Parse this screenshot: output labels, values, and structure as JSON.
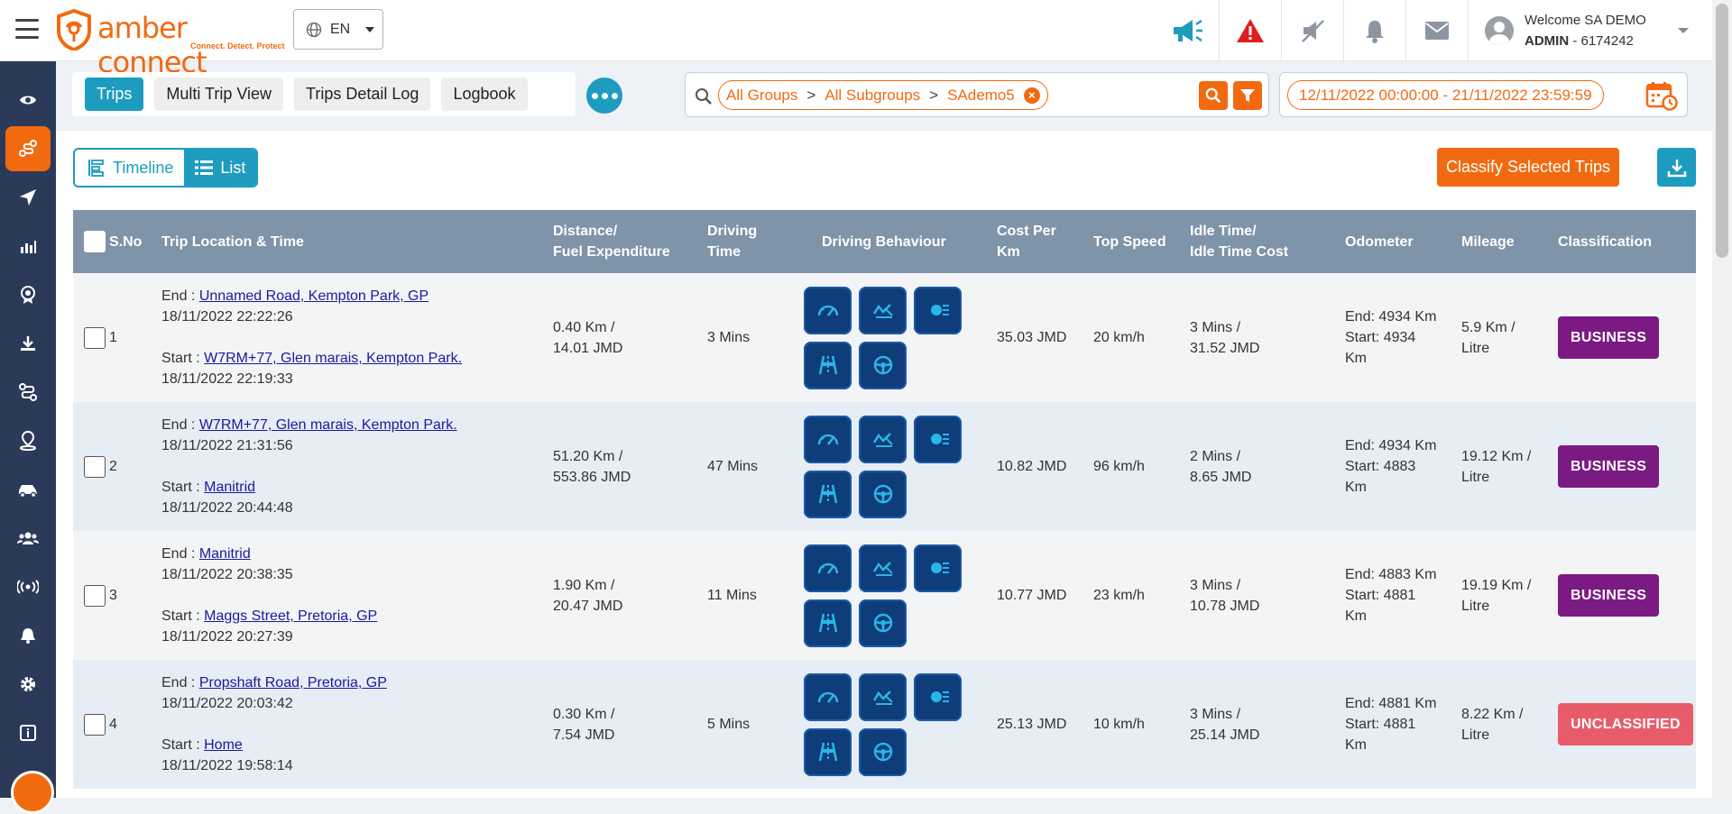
{
  "app": {
    "logo_text": "amber connect",
    "logo_tagline": "Connect. Detect. Protect",
    "language": "EN",
    "user_welcome": "Welcome SA DEMO",
    "user_role": "ADMIN",
    "user_id": " - 6174242"
  },
  "colors": {
    "brand_orange": "#f26a10",
    "accent_blue": "#1d9cc0",
    "sidebar": "#2c3a5a",
    "business": "#7b1a82",
    "unclassified": "#e85c6a"
  },
  "header_icons": [
    "megaphone-icon",
    "alert-icon",
    "mute-icon",
    "bell-icon",
    "mail-icon"
  ],
  "sidebar_items": [
    "eye-icon",
    "trips-icon",
    "navigate-icon",
    "reports-icon",
    "badge-icon",
    "download-icon",
    "route-icon",
    "location-icon",
    "vehicle-icon",
    "users-icon",
    "signal-icon",
    "notification-icon",
    "settings-icon",
    "info-icon"
  ],
  "tabs": [
    "Trips",
    "Multi Trip View",
    "Trips Detail Log",
    "Logbook"
  ],
  "filter": {
    "group": "All Groups",
    "subgroup": "All Subgroups",
    "vehicle": "SAdemo5",
    "separator": ">"
  },
  "date_range": "12/11/2022 00:00:00 - 21/11/2022 23:59:59",
  "view": {
    "timeline": "Timeline",
    "list": "List"
  },
  "classify_label": "Classify Selected Trips",
  "table": {
    "headers": {
      "sno": "S.No",
      "location": "Trip Location & Time",
      "distance_1": "Distance/",
      "distance_2": "Fuel Expenditure",
      "driving_1": "Driving",
      "driving_2": "Time",
      "behaviour": "Driving Behaviour",
      "cost_1": "Cost Per",
      "cost_2": "Km",
      "speed": "Top Speed",
      "idle_1": "Idle Time/",
      "idle_2": "Idle Time Cost",
      "odometer": "Odometer",
      "mileage": "Mileage",
      "classification": "Classification"
    },
    "end_label": "End : ",
    "start_label": "Start : ",
    "rows": [
      {
        "sno": "1",
        "end_loc": "Unnamed Road, Kempton Park, GP",
        "end_time": "18/11/2022 22:22:26",
        "start_loc": "W7RM+77, Glen marais, Kempton Park.",
        "start_time": "18/11/2022 22:19:33",
        "distance": "0.40 Km /",
        "fuel": "14.01 JMD",
        "driving": "3 Mins",
        "cost": "35.03 JMD",
        "speed": "20 km/h",
        "idle": "3 Mins /",
        "idle_cost": "31.52 JMD",
        "odo_end": "End: 4934 Km",
        "odo_start_1": "Start: 4934",
        "odo_start_2": "Km",
        "mileage_1": "5.9 Km /",
        "mileage_2": "Litre",
        "classification": "BUSINESS"
      },
      {
        "sno": "2",
        "end_loc": "W7RM+77, Glen marais, Kempton Park.",
        "end_time": "18/11/2022 21:31:56",
        "start_loc": "Manitrid",
        "start_time": "18/11/2022 20:44:48",
        "distance": "51.20 Km /",
        "fuel": "553.86 JMD",
        "driving": "47 Mins",
        "cost": "10.82 JMD",
        "speed": "96 km/h",
        "idle": "2 Mins /",
        "idle_cost": "8.65 JMD",
        "odo_end": "End: 4934 Km",
        "odo_start_1": "Start: 4883",
        "odo_start_2": "Km",
        "mileage_1": "19.12 Km /",
        "mileage_2": "Litre",
        "classification": "BUSINESS"
      },
      {
        "sno": "3",
        "end_loc": "Manitrid",
        "end_time": "18/11/2022 20:38:35",
        "start_loc": "Maggs Street, Pretoria, GP",
        "start_time": "18/11/2022 20:27:39",
        "distance": "1.90 Km /",
        "fuel": "20.47 JMD",
        "driving": "11 Mins",
        "cost": "10.77 JMD",
        "speed": "23 km/h",
        "idle": "3 Mins /",
        "idle_cost": "10.78 JMD",
        "odo_end": "End: 4883 Km",
        "odo_start_1": "Start: 4881",
        "odo_start_2": "Km",
        "mileage_1": "19.19 Km /",
        "mileage_2": "Litre",
        "classification": "BUSINESS"
      },
      {
        "sno": "4",
        "end_loc": "Propshaft Road, Pretoria, GP",
        "end_time": "18/11/2022 20:03:42",
        "start_loc": "Home",
        "start_time": "18/11/2022 19:58:14",
        "distance": "0.30 Km /",
        "fuel": "7.54 JMD",
        "driving": "5 Mins",
        "cost": "25.13 JMD",
        "speed": "10 km/h",
        "idle": "3 Mins /",
        "idle_cost": "25.14 JMD",
        "odo_end": "End: 4881 Km",
        "odo_start_1": "Start: 4881",
        "odo_start_2": "Km",
        "mileage_1": "8.22 Km /",
        "mileage_2": "Litre",
        "classification": "UNCLASSIFIED"
      }
    ]
  }
}
